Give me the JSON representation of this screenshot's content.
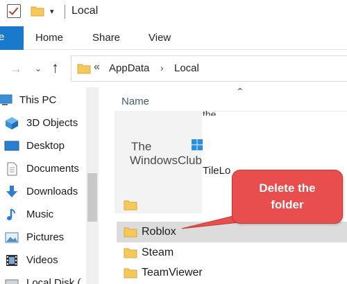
{
  "window": {
    "title": "Local"
  },
  "ribbon": {
    "file_label": "e",
    "tabs": [
      {
        "label": "Home"
      },
      {
        "label": "Share"
      },
      {
        "label": "View"
      }
    ]
  },
  "address": {
    "overflow": "«",
    "segments": [
      "AppData",
      "Local"
    ],
    "separator": "›"
  },
  "nav_pane": {
    "items": [
      {
        "label": "This PC",
        "icon": "computer-icon"
      },
      {
        "label": "3D Objects",
        "icon": "cube-icon"
      },
      {
        "label": "Desktop",
        "icon": "desktop-icon"
      },
      {
        "label": "Documents",
        "icon": "document-icon"
      },
      {
        "label": "Downloads",
        "icon": "download-arrow-icon"
      },
      {
        "label": "Music",
        "icon": "music-note-icon"
      },
      {
        "label": "Pictures",
        "icon": "picture-icon"
      },
      {
        "label": "Videos",
        "icon": "film-icon"
      },
      {
        "label": "Local Disk (",
        "icon": "disk-icon"
      }
    ]
  },
  "content": {
    "column_header": "Name",
    "clipped_top": "the",
    "clipped_row": "TileLo",
    "rows": [
      {
        "label": "Roblox",
        "selected": true
      },
      {
        "label": "Steam",
        "selected": false
      },
      {
        "label": "TeamViewer",
        "selected": false
      }
    ]
  },
  "watermark": {
    "line1": "The",
    "line2": "WindowsClub"
  },
  "callout": {
    "line1": "Delete the",
    "line2": "folder",
    "color": "#e84e4e"
  },
  "colors": {
    "file_tab": "#1979ca",
    "folder": "#f4c85a",
    "selection": "#dcdcdc"
  }
}
